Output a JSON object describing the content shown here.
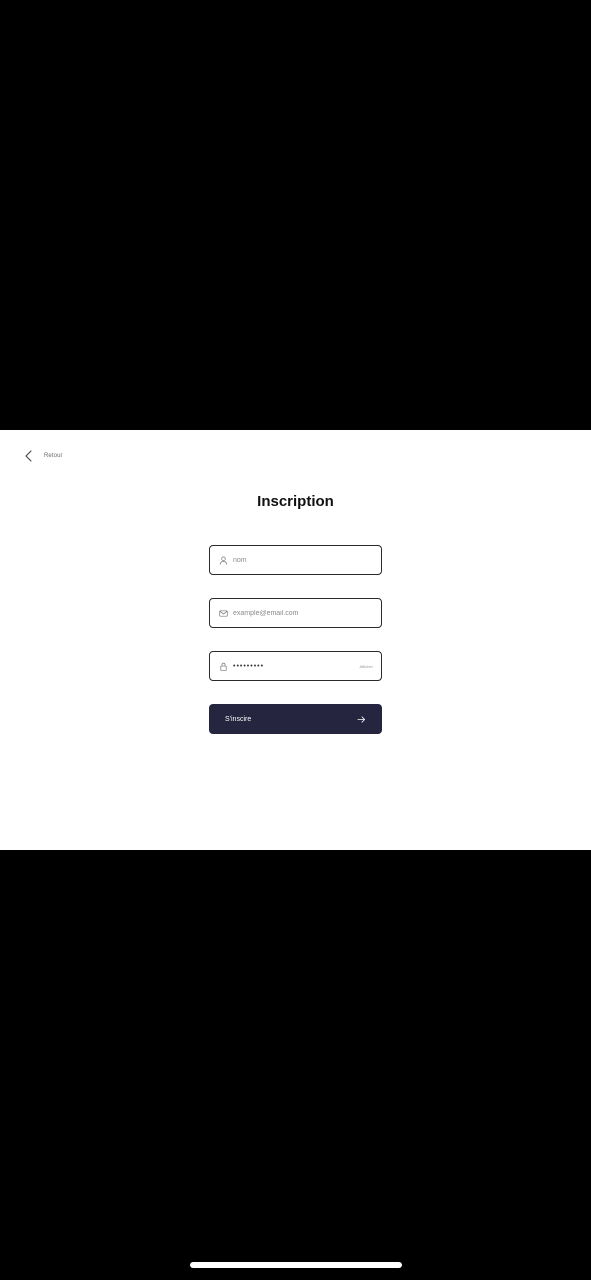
{
  "header": {
    "back_label": "Retour"
  },
  "page": {
    "title": "Inscription"
  },
  "form": {
    "name_field": {
      "value": "",
      "placeholder": "nom",
      "icon": "user-icon"
    },
    "email_field": {
      "value": "",
      "placeholder": "example@email.com",
      "icon": "mail-icon"
    },
    "password_field": {
      "value": "•••••••••",
      "icon": "lock-icon",
      "toggle_label": "Afficher"
    },
    "submit": {
      "label": "S'inscire",
      "icon": "arrow-right-icon"
    }
  },
  "colors": {
    "background": "#000000",
    "panel": "#ffffff",
    "button": "#25253f",
    "field_border": "#2a2a2a"
  }
}
